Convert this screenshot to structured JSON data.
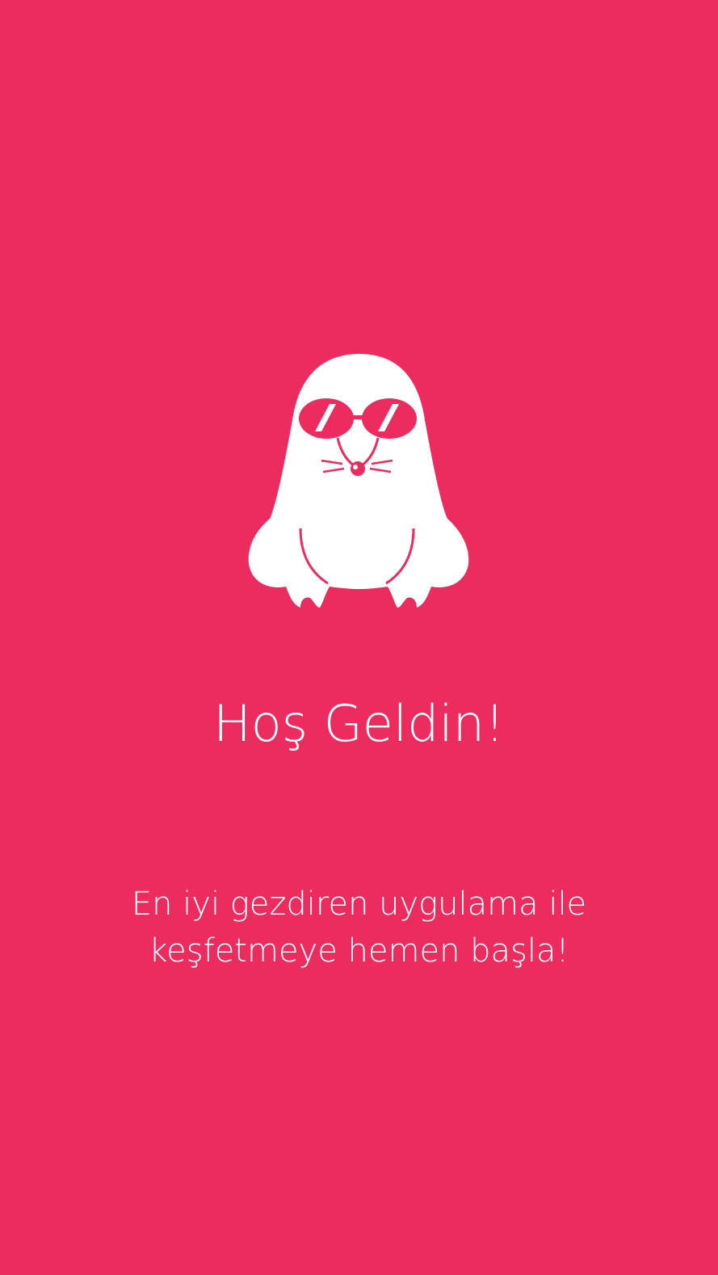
{
  "theme": {
    "background": "#EC2C5F",
    "foreground": "#FFFFFF"
  },
  "mascot": {
    "icon": "sunglasses-mole-mascot-icon"
  },
  "welcome": {
    "title": "Hoş Geldin!",
    "subtitle_line1": "En iyi gezdiren uygulama ile",
    "subtitle_line2": "keşfetmeye hemen başla!"
  }
}
